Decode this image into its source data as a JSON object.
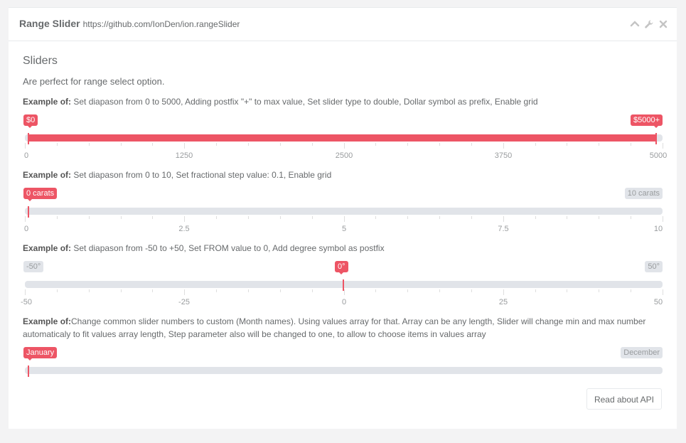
{
  "header": {
    "title": "Range Slider",
    "subtitle": "https://github.com/IonDen/ion.rangeSlider",
    "tools": [
      "chevron-up-icon",
      "wrench-icon",
      "close-icon"
    ]
  },
  "section": {
    "title": "Sliders",
    "lead": "Are perfect for range select option."
  },
  "colors": {
    "accent": "#ed5565",
    "track": "#e1e4e9",
    "text": "#676a6c"
  },
  "examples": [
    {
      "label": "Example of:",
      "text": " Set diapason from 0 to 5000, Adding postfix \"+\" to max value, Set slider type to double, Dollar symbol as prefix, Enable grid",
      "slider": {
        "type": "double",
        "min": 0,
        "max": 5000,
        "from": 0,
        "to": 5000,
        "from_label": "$0",
        "to_label": "$5000+",
        "grid": [
          "0",
          "1250",
          "2500",
          "3750",
          "5000"
        ]
      }
    },
    {
      "label": "Example of:",
      "text": " Set diapason from 0 to 10, Set fractional step value: 0.1, Enable grid",
      "slider": {
        "type": "single",
        "min": 0,
        "max": 10,
        "value": 0,
        "value_label": "0 carats",
        "max_label": "10 carats",
        "grid": [
          "0",
          "2.5",
          "5",
          "7.5",
          "10"
        ]
      }
    },
    {
      "label": "Example of:",
      "text": " Set diapason from -50 to +50, Set FROM value to 0, Add degree symbol as postfix",
      "slider": {
        "type": "single",
        "min": -50,
        "max": 50,
        "value": 0,
        "min_label": "-50°",
        "value_label": "0°",
        "max_label": "50°",
        "grid": [
          "-50",
          "-25",
          "0",
          "25",
          "50"
        ]
      }
    },
    {
      "label": "Example of:",
      "text": "Change common slider numbers to custom (Month names). Using values array for that. Array can be any length, Slider will change min and max number automaticaly to fit values array length, Step parameter also will be changed to one, to allow to choose items in values array",
      "slider": {
        "type": "single",
        "value": "January",
        "value_label": "January",
        "max_label": "December"
      }
    }
  ],
  "api_button": "Read about API"
}
